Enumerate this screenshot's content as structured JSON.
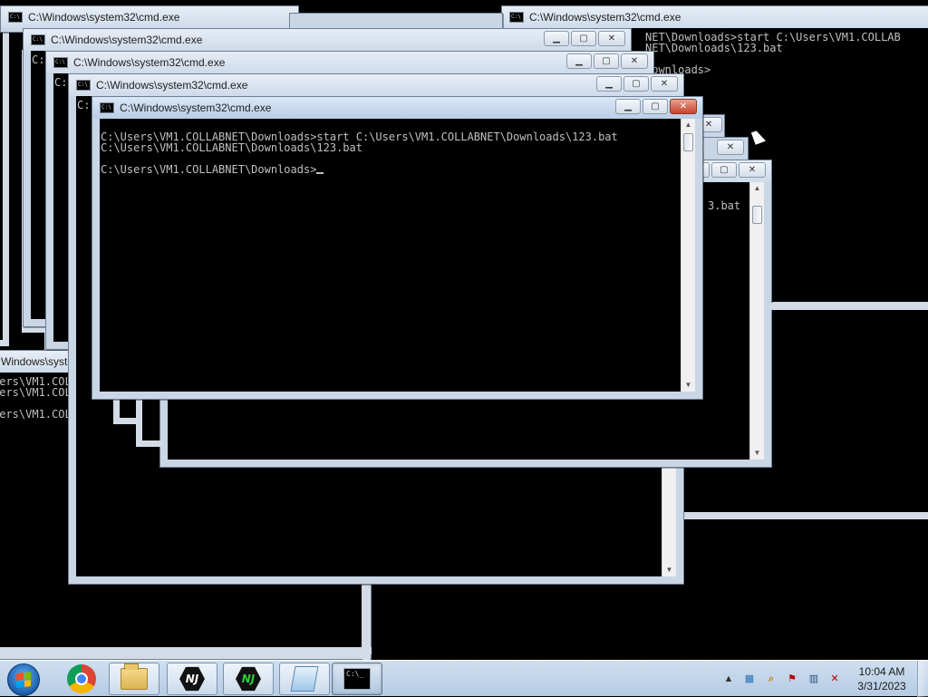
{
  "windows": {
    "title": "C:\\Windows\\system32\\cmd.exe",
    "partial_title": "Windows\\syste"
  },
  "active_console": {
    "lines": [
      "C:\\Users\\VM1.COLLABNET\\Downloads>start C:\\Users\\VM1.COLLABNET\\Downloads\\123.bat",
      "C:\\Users\\VM1.COLLABNET\\Downloads\\123.bat",
      "",
      "C:\\Users\\VM1.COLLABNET\\Downloads>"
    ]
  },
  "back_console_right": {
    "lines": [
      "NET\\Downloads>start C:\\Users\\VM1.COLLAB",
      "NET\\Downloads\\123.bat",
      "",
      "Downloads>"
    ]
  },
  "back_console_mid": {
    "lines": [
      "3.bat"
    ]
  },
  "back_console_left": {
    "lines": [
      "sers\\VM1.COL",
      "sers\\VM1.COL",
      "",
      "sers\\VM1.COL"
    ]
  },
  "stacked_prefix": {
    "c": "C:"
  },
  "taskbar": {
    "start_label": "Start",
    "items": [
      "Google Chrome",
      "Windows Explorer",
      "NJ",
      "NJ",
      "Notepad",
      "cmd.exe"
    ],
    "nj_text": "NJ",
    "cmd_icon_text": "C:\\_"
  },
  "clock": {
    "time": "10:04 AM",
    "date": "3/31/2023"
  },
  "colors": {
    "console_bg": "#000000",
    "console_fg": "#c0c0c0",
    "titlebar": "#c9d6e6",
    "taskbar": "#c4d7ec"
  }
}
